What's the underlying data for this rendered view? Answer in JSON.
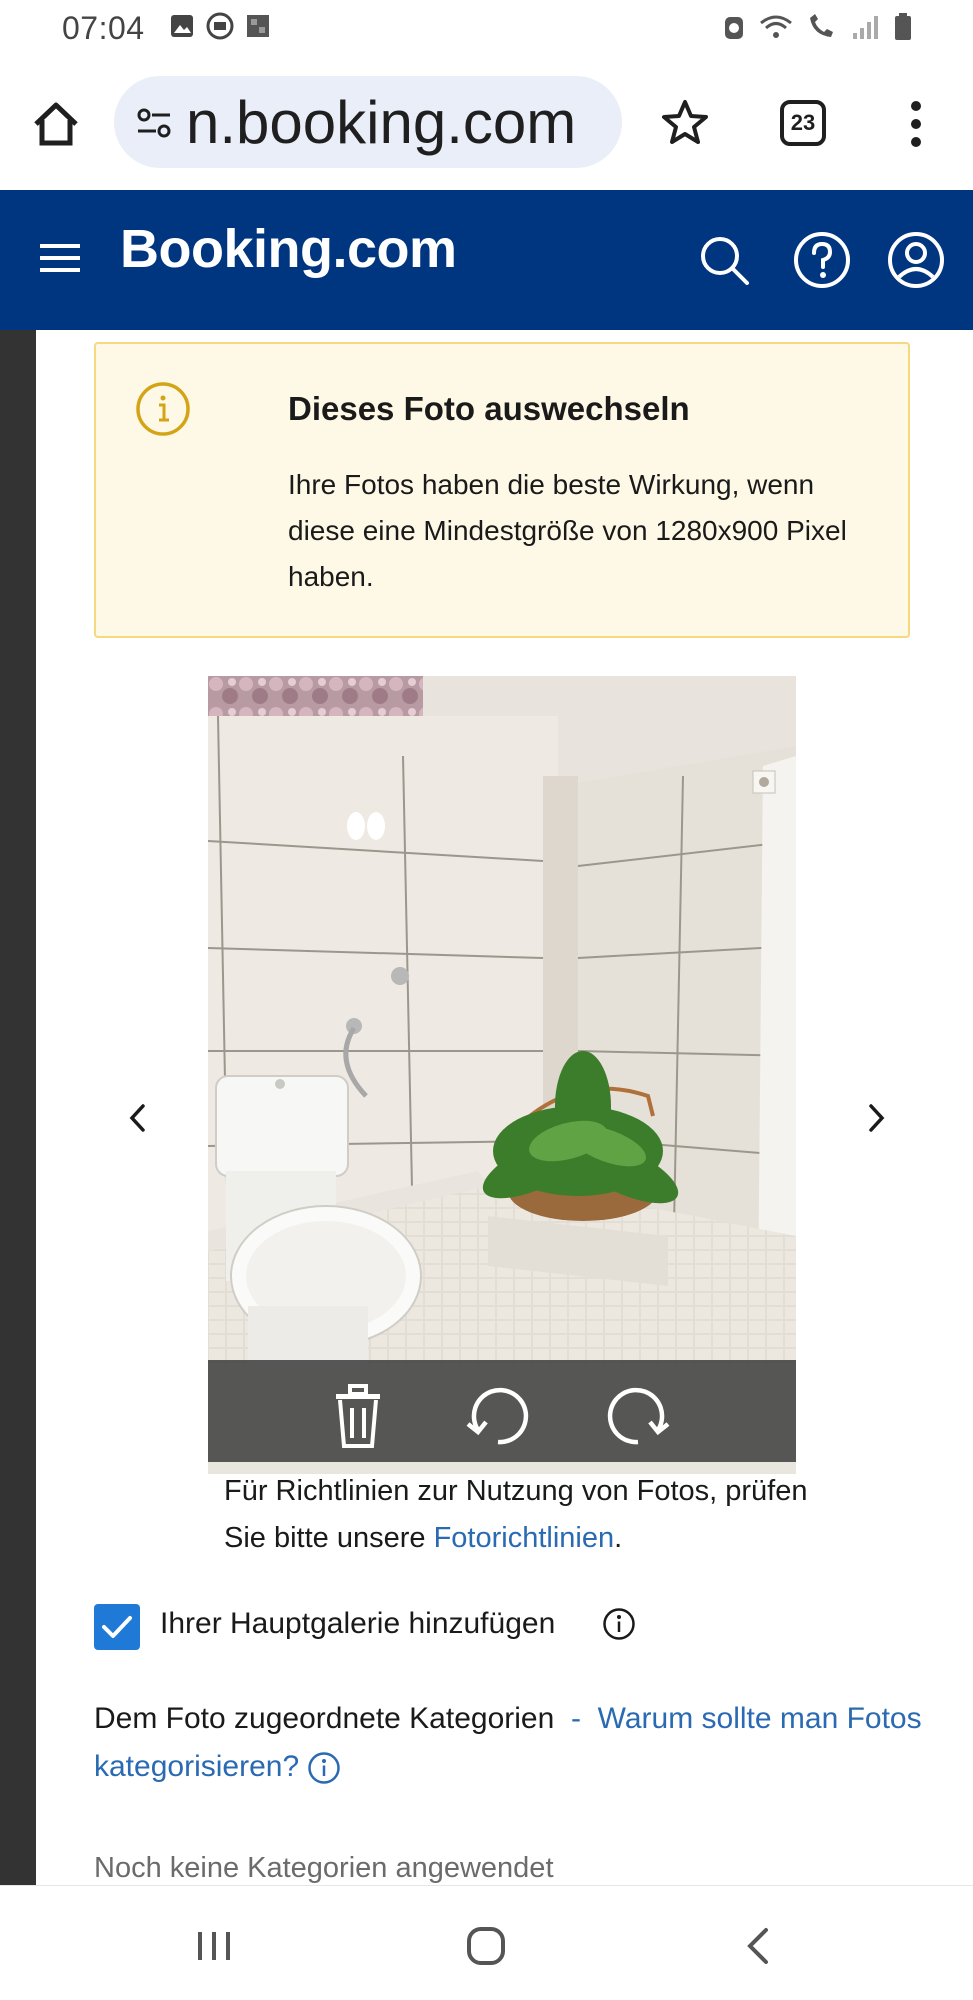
{
  "status_bar": {
    "time": "07:04",
    "left_icons": [
      "image-icon",
      "mail-icon",
      "cast-icon"
    ],
    "right_icons": [
      "alarm-icon",
      "wifi-icon",
      "call-icon",
      "signal-icon",
      "battery-icon"
    ]
  },
  "browser": {
    "url": "n.booking.com",
    "tab_count": "23"
  },
  "header": {
    "logo": "Booking.com",
    "brand_color": "#003580"
  },
  "alert": {
    "title": "Dieses Foto auswechseln",
    "body": "Ihre Fotos haben die beste Wirkung, wenn diese eine Mindestgröße von 1280x900 Pixel haben."
  },
  "photo": {
    "toolbar": [
      "trash-icon",
      "rotate-left-icon",
      "rotate-right-icon"
    ]
  },
  "guidelines": {
    "text_before": "Für Richtlinien zur Nutzung von Fotos, prüfen Sie bitte unsere ",
    "link": "Fotorichtlinien",
    "text_after": "."
  },
  "gallery_checkbox": {
    "label": "Ihrer Hauptgalerie hinzufügen",
    "checked": true
  },
  "categories": {
    "label": "Dem Foto zugeordnete Kategorien",
    "separator": "-",
    "link": "Warum sollte man Fotos kategorisieren?",
    "empty_text": "Noch keine Kategorien angewendet"
  }
}
